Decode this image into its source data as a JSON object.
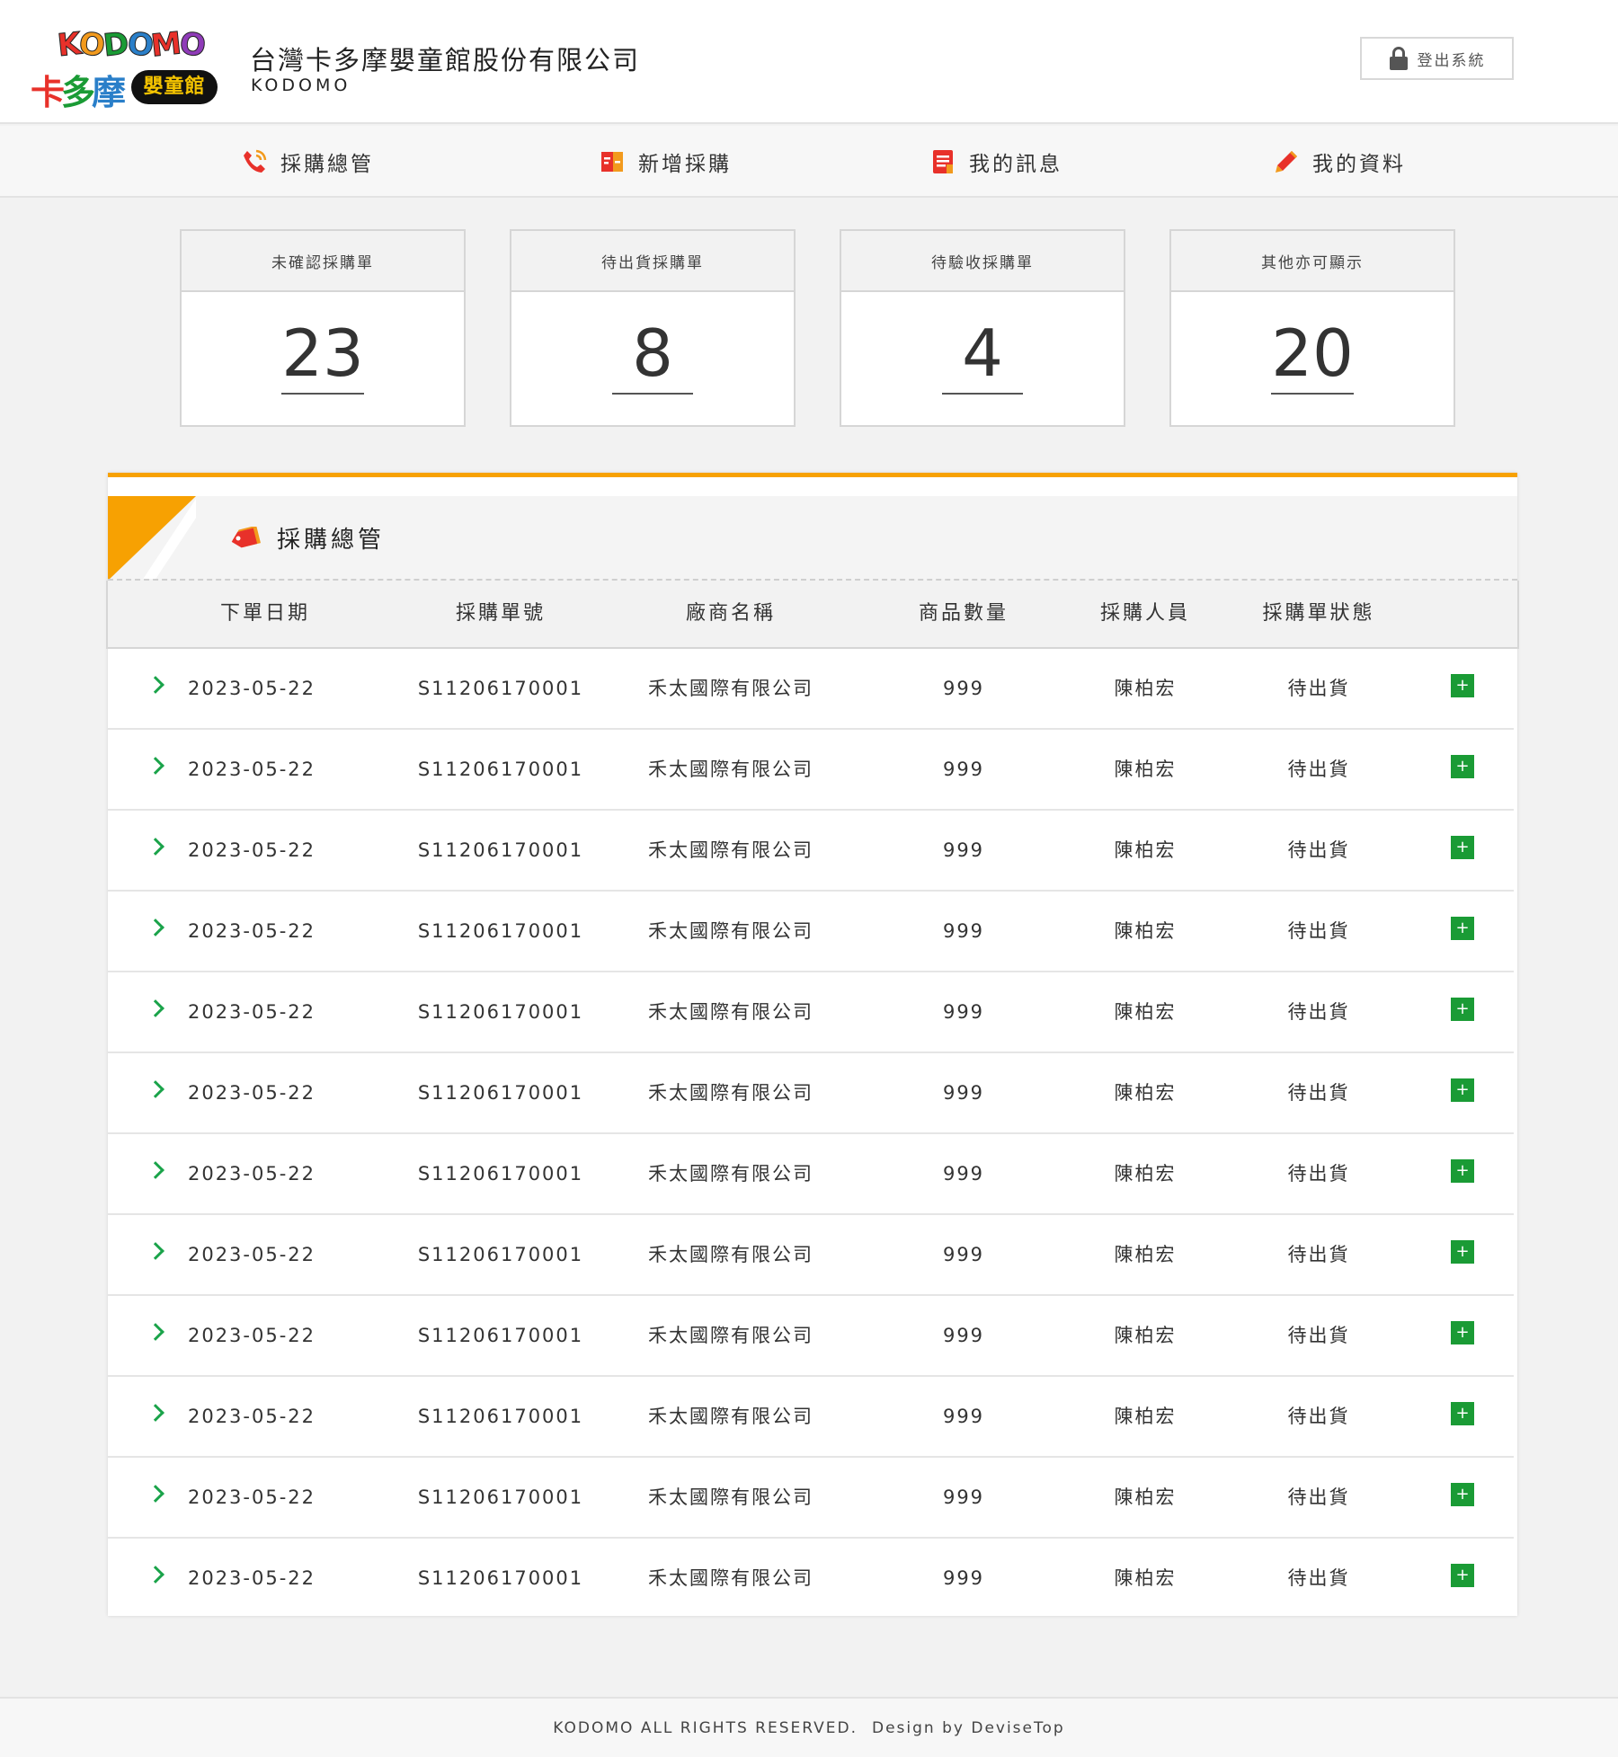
{
  "header": {
    "logo_word": [
      "K",
      "O",
      "D",
      "O",
      "M",
      "O"
    ],
    "logo_colors": [
      "#e8312a",
      "#f29a1d",
      "#1a9b35",
      "#2a7fc9",
      "#e8312a",
      "#8f3bb8"
    ],
    "logo_cn": "卡多摩",
    "logo_badge": "嬰童館",
    "company_name": "台灣卡多摩嬰童館股份有限公司",
    "company_en": "KODOMO",
    "logout_label": "登出系統"
  },
  "nav": {
    "items": [
      {
        "label": "採購總管",
        "icon": "phone-icon"
      },
      {
        "label": "新增採購",
        "icon": "add-document-icon"
      },
      {
        "label": "我的訊息",
        "icon": "message-list-icon"
      },
      {
        "label": "我的資料",
        "icon": "pencil-icon"
      }
    ]
  },
  "stats": [
    {
      "label": "未確認採購單",
      "value": "23"
    },
    {
      "label": "待出貨採購單",
      "value": "8"
    },
    {
      "label": "待驗收採購單",
      "value": "4"
    },
    {
      "label": "其他亦可顯示",
      "value": "20"
    }
  ],
  "panel": {
    "title": "採購總管",
    "columns": [
      "下單日期",
      "採購單號",
      "廠商名稱",
      "商品數量",
      "採購人員",
      "採購單狀態"
    ],
    "rows": [
      {
        "date": "2023-05-22",
        "order_no": "S11206170001",
        "vendor": "禾太國際有限公司",
        "qty": "999",
        "buyer": "陳柏宏",
        "status": "待出貨"
      },
      {
        "date": "2023-05-22",
        "order_no": "S11206170001",
        "vendor": "禾太國際有限公司",
        "qty": "999",
        "buyer": "陳柏宏",
        "status": "待出貨"
      },
      {
        "date": "2023-05-22",
        "order_no": "S11206170001",
        "vendor": "禾太國際有限公司",
        "qty": "999",
        "buyer": "陳柏宏",
        "status": "待出貨"
      },
      {
        "date": "2023-05-22",
        "order_no": "S11206170001",
        "vendor": "禾太國際有限公司",
        "qty": "999",
        "buyer": "陳柏宏",
        "status": "待出貨"
      },
      {
        "date": "2023-05-22",
        "order_no": "S11206170001",
        "vendor": "禾太國際有限公司",
        "qty": "999",
        "buyer": "陳柏宏",
        "status": "待出貨"
      },
      {
        "date": "2023-05-22",
        "order_no": "S11206170001",
        "vendor": "禾太國際有限公司",
        "qty": "999",
        "buyer": "陳柏宏",
        "status": "待出貨"
      },
      {
        "date": "2023-05-22",
        "order_no": "S11206170001",
        "vendor": "禾太國際有限公司",
        "qty": "999",
        "buyer": "陳柏宏",
        "status": "待出貨"
      },
      {
        "date": "2023-05-22",
        "order_no": "S11206170001",
        "vendor": "禾太國際有限公司",
        "qty": "999",
        "buyer": "陳柏宏",
        "status": "待出貨"
      },
      {
        "date": "2023-05-22",
        "order_no": "S11206170001",
        "vendor": "禾太國際有限公司",
        "qty": "999",
        "buyer": "陳柏宏",
        "status": "待出貨"
      },
      {
        "date": "2023-05-22",
        "order_no": "S11206170001",
        "vendor": "禾太國際有限公司",
        "qty": "999",
        "buyer": "陳柏宏",
        "status": "待出貨"
      },
      {
        "date": "2023-05-22",
        "order_no": "S11206170001",
        "vendor": "禾太國際有限公司",
        "qty": "999",
        "buyer": "陳柏宏",
        "status": "待出貨"
      },
      {
        "date": "2023-05-22",
        "order_no": "S11206170001",
        "vendor": "禾太國際有限公司",
        "qty": "999",
        "buyer": "陳柏宏",
        "status": "待出貨"
      }
    ],
    "expand_label": "+"
  },
  "footer": {
    "rights": "KODOMO ALL RIGHTS RESERVED.",
    "design": "Design by DeviseTop"
  },
  "colors": {
    "accent": "#f7a102",
    "add_button": "#1a9b35",
    "chevron": "#1aa34a"
  }
}
